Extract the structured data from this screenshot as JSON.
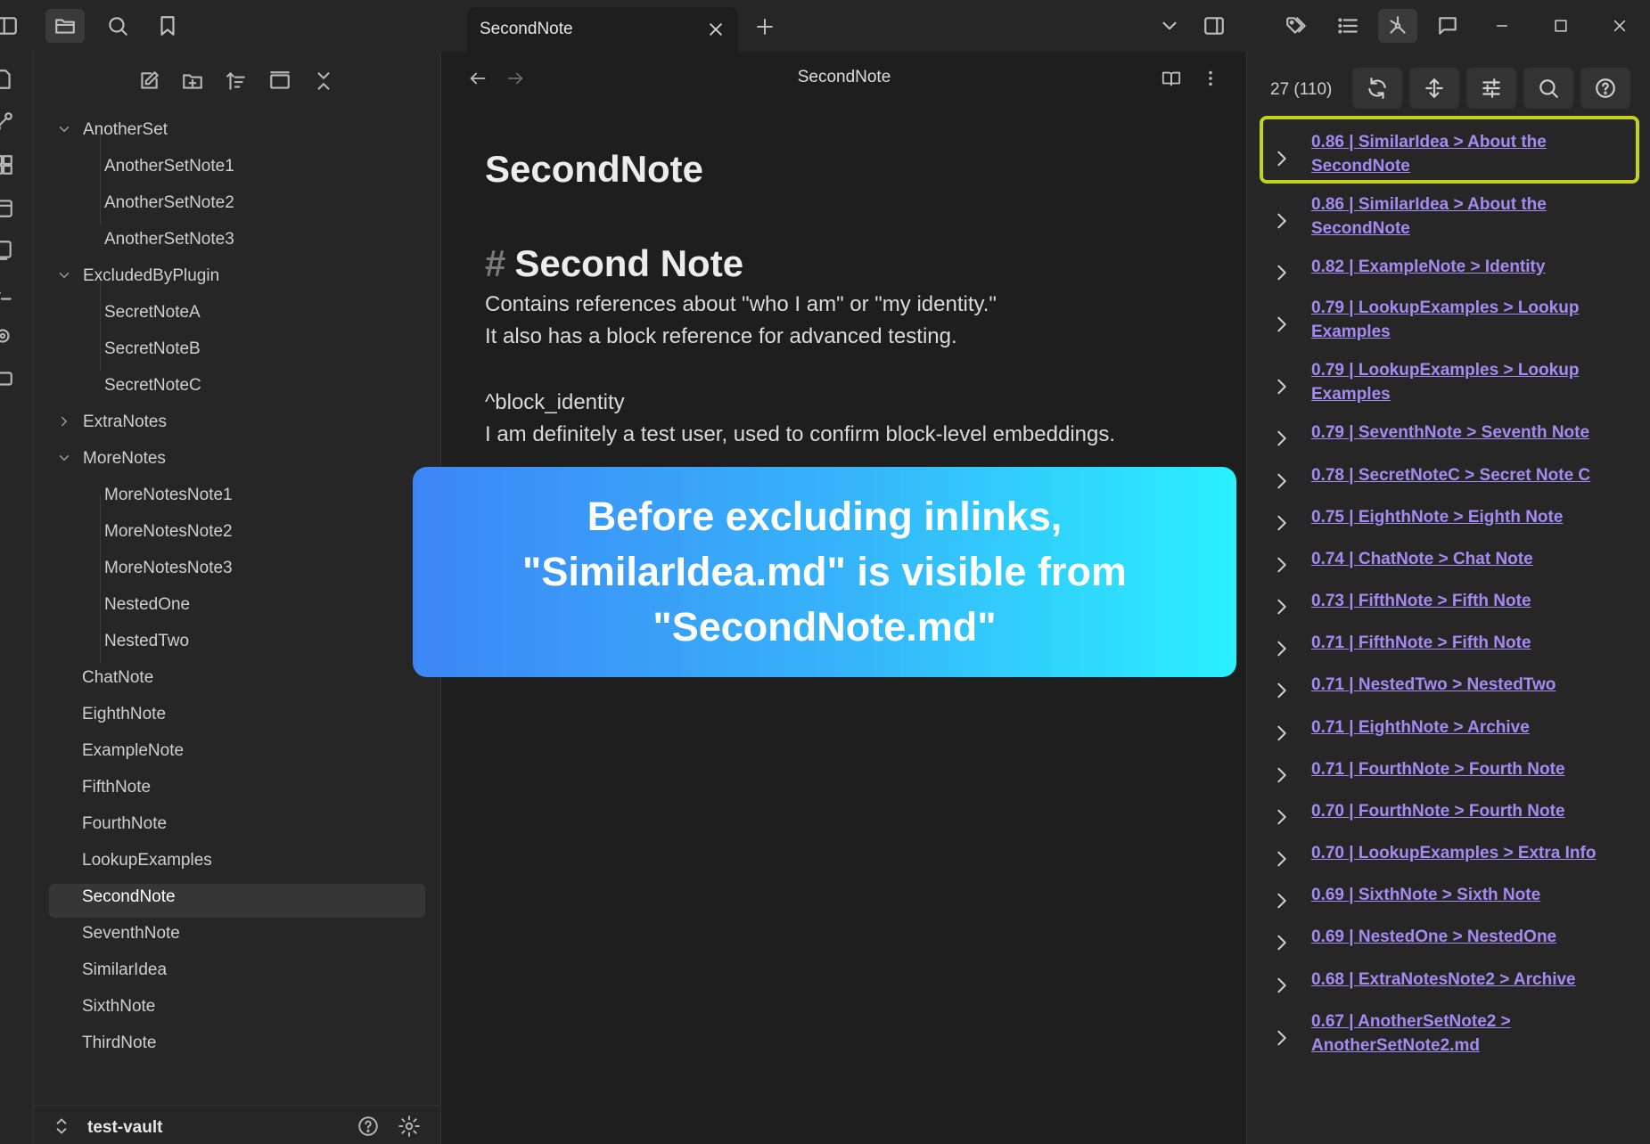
{
  "tab": {
    "title": "SecondNote"
  },
  "sidebar": {
    "tree": [
      {
        "label": "AnotherSet",
        "type": "folder",
        "expanded": true
      },
      {
        "label": "AnotherSetNote1",
        "type": "file",
        "child": true
      },
      {
        "label": "AnotherSetNote2",
        "type": "file",
        "child": true
      },
      {
        "label": "AnotherSetNote3",
        "type": "file",
        "child": true
      },
      {
        "label": "ExcludedByPlugin",
        "type": "folder",
        "expanded": true
      },
      {
        "label": "SecretNoteA",
        "type": "file",
        "child": true
      },
      {
        "label": "SecretNoteB",
        "type": "file",
        "child": true
      },
      {
        "label": "SecretNoteC",
        "type": "file",
        "child": true
      },
      {
        "label": "ExtraNotes",
        "type": "folder",
        "expanded": false
      },
      {
        "label": "MoreNotes",
        "type": "folder",
        "expanded": true
      },
      {
        "label": "MoreNotesNote1",
        "type": "file",
        "child": true
      },
      {
        "label": "MoreNotesNote2",
        "type": "file",
        "child": true
      },
      {
        "label": "MoreNotesNote3",
        "type": "file",
        "child": true
      },
      {
        "label": "NestedOne",
        "type": "file",
        "child": true
      },
      {
        "label": "NestedTwo",
        "type": "file",
        "child": true
      },
      {
        "label": "ChatNote",
        "type": "file"
      },
      {
        "label": "EighthNote",
        "type": "file"
      },
      {
        "label": "ExampleNote",
        "type": "file"
      },
      {
        "label": "FifthNote",
        "type": "file"
      },
      {
        "label": "FourthNote",
        "type": "file"
      },
      {
        "label": "LookupExamples",
        "type": "file"
      },
      {
        "label": "SecondNote",
        "type": "file",
        "selected": true
      },
      {
        "label": "SeventhNote",
        "type": "file"
      },
      {
        "label": "SimilarIdea",
        "type": "file"
      },
      {
        "label": "SixthNote",
        "type": "file"
      },
      {
        "label": "ThirdNote",
        "type": "file"
      }
    ],
    "vault_name": "test-vault"
  },
  "editor": {
    "view_title": "SecondNote",
    "note_title": "SecondNote",
    "heading_hash": "#",
    "heading": "Second Note",
    "lines": [
      "Contains references about \"who I am\" or \"my identity.\"",
      "It also has a block reference for advanced testing.",
      "^block_identity",
      "I am definitely a test user, used to confirm block-level embeddings."
    ]
  },
  "banner": {
    "lines": [
      "Before excluding inlinks,",
      "\"SimilarIdea.md\" is visible from",
      "\"SecondNote.md\""
    ]
  },
  "right_panel": {
    "count": "27 (110)",
    "results": [
      "0.86 | SimilarIdea > About the SecondNote",
      "0.86 | SimilarIdea > About the SecondNote",
      "0.82 | ExampleNote > Identity",
      "0.79 | LookupExamples > Lookup Examples",
      "0.79 | LookupExamples > Lookup Examples",
      "0.79 | SeventhNote > Seventh Note",
      "0.78 | SecretNoteC > Secret Note C",
      "0.75 | EighthNote > Eighth Note",
      "0.74 | ChatNote > Chat Note",
      "0.73 | FifthNote > Fifth Note",
      "0.71 | FifthNote > Fifth Note",
      "0.71 | NestedTwo > NestedTwo",
      "0.71 | EighthNote > Archive",
      "0.71 | FourthNote > Fourth Note",
      "0.70 | FourthNote > Fourth Note",
      "0.70 | LookupExamples > Extra Info",
      "0.69 | SixthNote > Sixth Note",
      "0.69 | NestedOne > NestedOne",
      "0.68 | ExtraNotesNote2 > Archive",
      "0.67 | AnotherSetNote2 > AnotherSetNote2.md"
    ]
  },
  "colors": {
    "accent_link": "#a48bf2",
    "highlight": "#c6d21a",
    "banner_start": "#3d86f6",
    "banner_end": "#2af0ff"
  }
}
